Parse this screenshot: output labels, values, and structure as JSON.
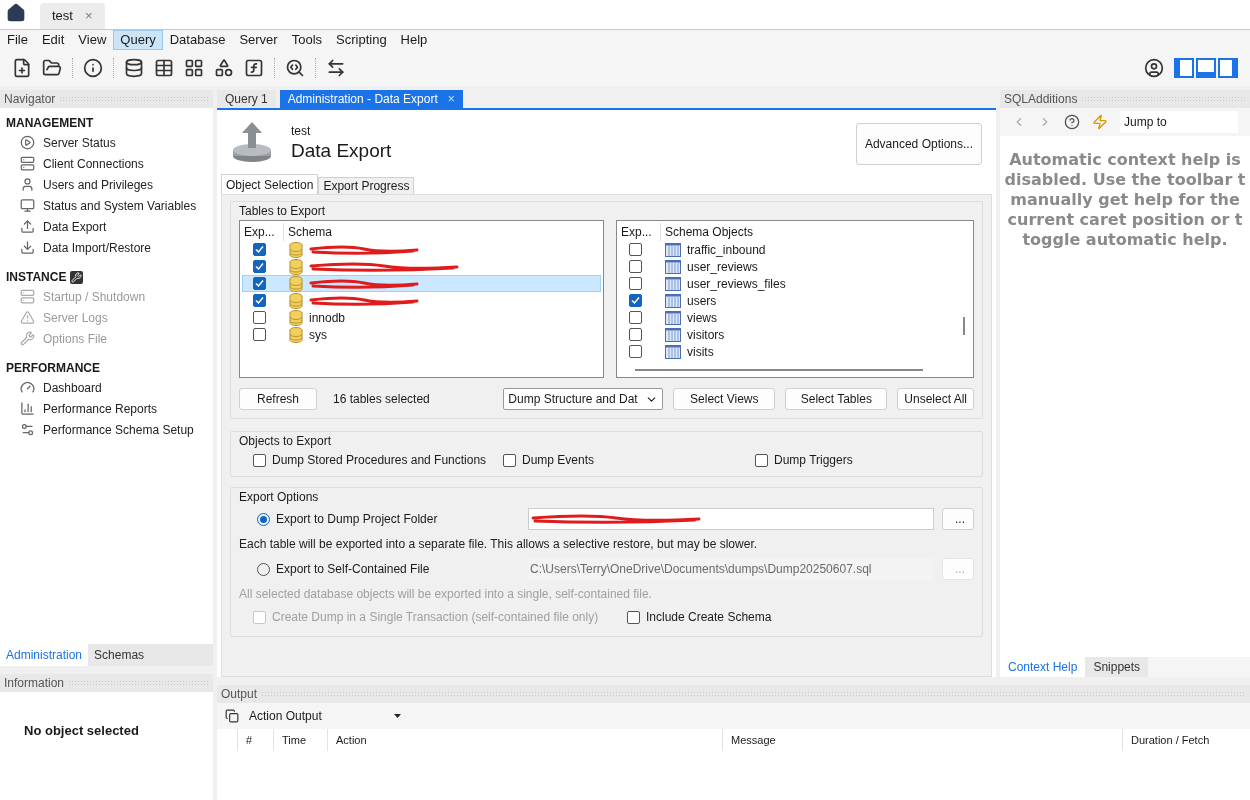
{
  "app_tabs": [
    {
      "label": "test",
      "close": "×",
      "selected": true
    }
  ],
  "menu": [
    {
      "label": "File",
      "selected": false
    },
    {
      "label": "Edit",
      "selected": false
    },
    {
      "label": "View",
      "selected": false
    },
    {
      "label": "Query",
      "selected": true
    },
    {
      "label": "Database",
      "selected": false
    },
    {
      "label": "Server",
      "selected": false
    },
    {
      "label": "Tools",
      "selected": false
    },
    {
      "label": "Scripting",
      "selected": false
    },
    {
      "label": "Help",
      "selected": false
    }
  ],
  "navigator": {
    "title": "Navigator",
    "sections": [
      {
        "title": "MANAGEMENT",
        "items": [
          {
            "label": "Server Status",
            "disabled": false
          },
          {
            "label": "Client Connections",
            "disabled": false
          },
          {
            "label": "Users and Privileges",
            "disabled": false
          },
          {
            "label": "Status and System Variables",
            "disabled": false
          },
          {
            "label": "Data Export",
            "disabled": false
          },
          {
            "label": "Data Import/Restore",
            "disabled": false
          }
        ]
      },
      {
        "title": "INSTANCE",
        "items": [
          {
            "label": "Startup / Shutdown",
            "disabled": true
          },
          {
            "label": "Server Logs",
            "disabled": true
          },
          {
            "label": "Options File",
            "disabled": true
          }
        ]
      },
      {
        "title": "PERFORMANCE",
        "items": [
          {
            "label": "Dashboard",
            "disabled": false
          },
          {
            "label": "Performance Reports",
            "disabled": false
          },
          {
            "label": "Performance Schema Setup",
            "disabled": false
          }
        ]
      }
    ],
    "tabs": [
      {
        "label": "Administration",
        "selected": true
      },
      {
        "label": "Schemas",
        "selected": false
      }
    ]
  },
  "information": {
    "title": "Information",
    "message": "No object selected"
  },
  "editor_tabs": [
    {
      "label": "Query 1",
      "selected": false
    },
    {
      "label": "Administration - Data Export",
      "selected": true,
      "close": "×"
    }
  ],
  "header": {
    "connection": "test",
    "title": "Data Export",
    "advanced_button": "Advanced Options..."
  },
  "sub_tabs": [
    {
      "label": "Object Selection",
      "selected": true
    },
    {
      "label": "Export Progress",
      "selected": false
    }
  ],
  "tables_to_export": {
    "title": "Tables to Export",
    "schemas": {
      "columns": [
        "Exp...",
        "Schema"
      ],
      "rows": [
        {
          "kind": "redacted",
          "checked": true,
          "selected": false
        },
        {
          "kind": "redacted",
          "checked": true,
          "selected": false
        },
        {
          "kind": "redacted",
          "checked": true,
          "selected": true
        },
        {
          "kind": "redacted",
          "checked": true,
          "selected": false
        },
        {
          "kind": "text",
          "name": "innodb",
          "checked": false,
          "selected": false
        },
        {
          "kind": "text",
          "name": "sys",
          "checked": false,
          "selected": false
        }
      ]
    },
    "objects": {
      "columns": [
        "Exp...",
        "Schema Objects"
      ],
      "rows": [
        {
          "name": "traffic_inbound",
          "checked": false
        },
        {
          "name": "user_reviews",
          "checked": false
        },
        {
          "name": "user_reviews_files",
          "checked": false
        },
        {
          "name": "users",
          "checked": true
        },
        {
          "name": "views",
          "checked": false
        },
        {
          "name": "visitors",
          "checked": false
        },
        {
          "name": "visits",
          "checked": false
        }
      ]
    },
    "refresh": "Refresh",
    "count": "16 tables selected",
    "dump_mode": "Dump Structure and Dat",
    "buttons": [
      "Select Views",
      "Select Tables",
      "Unselect All"
    ]
  },
  "objects_to_export": {
    "title": "Objects to Export",
    "options": [
      {
        "label": "Dump Stored Procedures and Functions",
        "checked": false
      },
      {
        "label": "Dump Events",
        "checked": false
      },
      {
        "label": "Dump Triggers",
        "checked": false
      }
    ]
  },
  "export_options": {
    "title": "Export Options",
    "targets": [
      {
        "label": "Export to Dump Project Folder",
        "selected": true,
        "value_redacted": true,
        "browse": "...",
        "note": "Each table will be exported into a separate file. This allows a selective restore, but may be slower."
      },
      {
        "label": "Export to Self-Contained File",
        "selected": false,
        "value": "C:\\Users\\Terry\\OneDrive\\Documents\\dumps\\Dump20250607.sql",
        "browse": "...",
        "note": "All selected database objects will be exported into a single, self-contained file."
      }
    ],
    "checks": [
      {
        "label": "Create Dump in a Single Transaction (self-contained file only)",
        "checked": false,
        "disabled": true
      },
      {
        "label": "Include Create Schema",
        "checked": false,
        "disabled": false
      }
    ]
  },
  "sql_additions": {
    "title": "SQLAdditions",
    "jump": "Jump to",
    "help_lines": [
      "Automatic context help is",
      "disabled. Use the toolbar t",
      "manually get help for the",
      "current caret position or t",
      "toggle automatic help."
    ],
    "tabs": [
      {
        "label": "Context Help",
        "selected": true
      },
      {
        "label": "Snippets",
        "selected": false
      }
    ]
  },
  "output": {
    "title": "Output",
    "mode": "Action Output",
    "columns": [
      "#",
      "Time",
      "Action",
      "Message",
      "Duration / Fetch"
    ]
  }
}
